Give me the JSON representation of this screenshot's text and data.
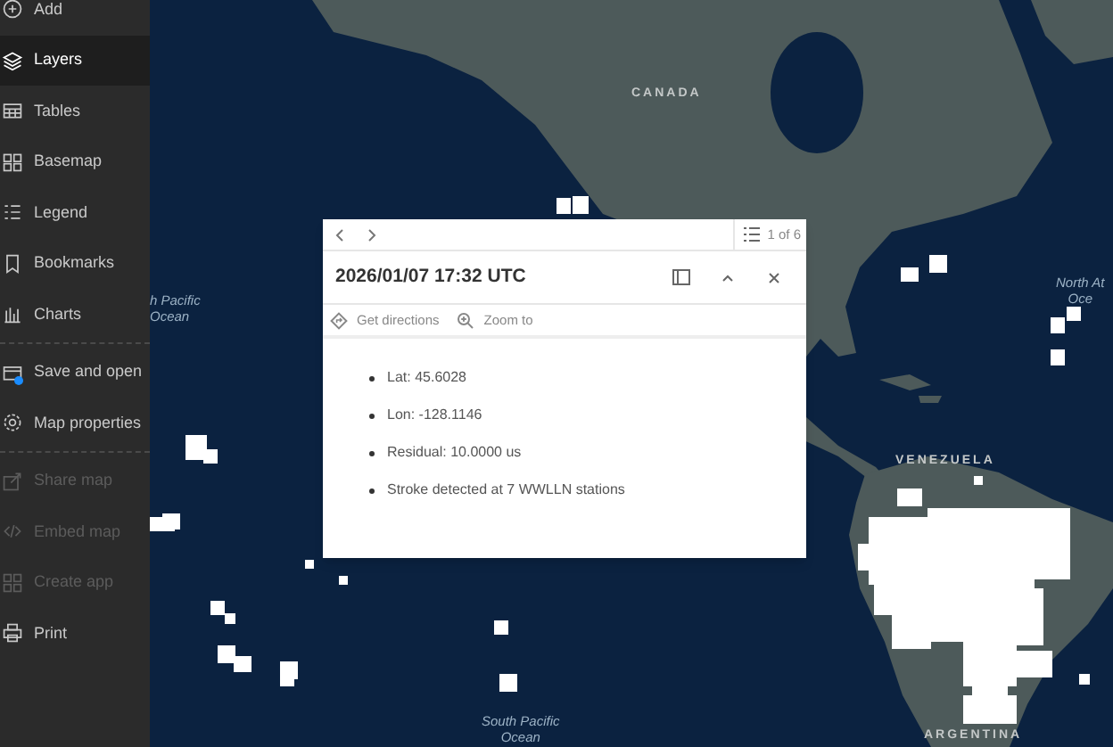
{
  "sidebar": {
    "groups": [
      {
        "items": [
          {
            "label": "Add",
            "selected": false,
            "disabled": false,
            "dot": false
          },
          {
            "label": "Layers",
            "selected": true,
            "disabled": false,
            "dot": false
          },
          {
            "label": "Tables",
            "selected": false,
            "disabled": false,
            "dot": false
          },
          {
            "label": "Basemap",
            "selected": false,
            "disabled": false,
            "dot": false
          },
          {
            "label": "Legend",
            "selected": false,
            "disabled": false,
            "dot": false
          },
          {
            "label": "Bookmarks",
            "selected": false,
            "disabled": false,
            "dot": false
          },
          {
            "label": "Charts",
            "selected": false,
            "disabled": false,
            "dot": false
          }
        ]
      },
      {
        "items": [
          {
            "label": "Save and open",
            "selected": false,
            "disabled": false,
            "dot": true
          },
          {
            "label": "Map properties",
            "selected": false,
            "disabled": false,
            "dot": false
          }
        ]
      },
      {
        "items": [
          {
            "label": "Share map",
            "selected": false,
            "disabled": true,
            "dot": false
          },
          {
            "label": "Embed map",
            "selected": false,
            "disabled": true,
            "dot": false
          },
          {
            "label": "Create app",
            "selected": false,
            "disabled": true,
            "dot": false
          },
          {
            "label": "Print",
            "selected": false,
            "disabled": false,
            "dot": false
          }
        ]
      }
    ]
  },
  "map": {
    "labels": [
      {
        "kind": "country",
        "lines": [
          "CANADA"
        ]
      },
      {
        "kind": "ocean",
        "lines": [
          "h Pacific",
          "Ocean"
        ]
      },
      {
        "kind": "ocean",
        "lines": [
          "North At",
          "Oce"
        ]
      },
      {
        "kind": "country",
        "lines": [
          "VENEZUELA"
        ]
      },
      {
        "kind": "ocean",
        "lines": [
          "South Pacific",
          "Ocean"
        ]
      },
      {
        "kind": "country",
        "lines": [
          "ARGENTINA"
        ]
      }
    ]
  },
  "popup": {
    "pager": "1 of 6",
    "title": "2026/01/07 17:32 UTC",
    "actions": [
      "Get directions",
      "Zoom to"
    ],
    "fields": [
      "Lat: 45.6028",
      "Lon: -128.1146",
      "Residual: 10.0000 us",
      "Stroke detected at 7 WWLLN stations"
    ]
  }
}
